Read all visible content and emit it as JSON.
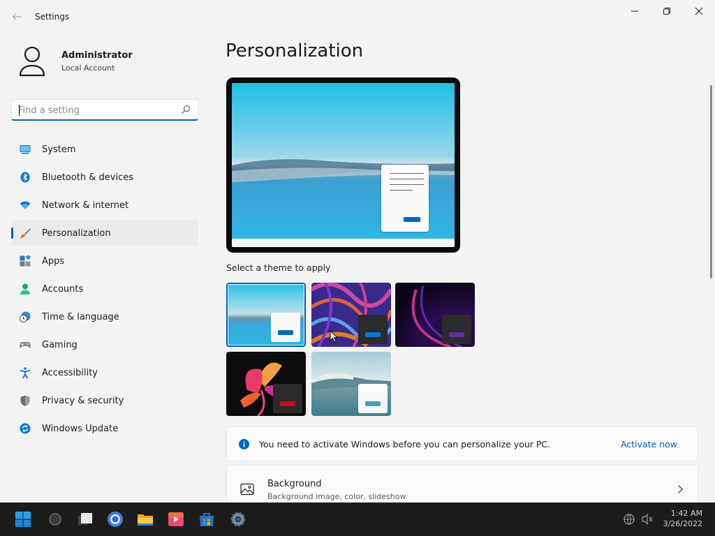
{
  "titlebar": {
    "app_title": "Settings",
    "back_icon": "back-arrow-icon",
    "controls": [
      "minimize-icon",
      "restore-icon",
      "close-icon"
    ]
  },
  "user": {
    "name": "Administrator",
    "account_type": "Local Account"
  },
  "search": {
    "placeholder": "Find a setting",
    "value": ""
  },
  "sidebar": {
    "items": [
      {
        "label": "System",
        "icon": "system-icon",
        "active": false
      },
      {
        "label": "Bluetooth & devices",
        "icon": "bluetooth-icon",
        "active": false
      },
      {
        "label": "Network & internet",
        "icon": "wifi-icon",
        "active": false
      },
      {
        "label": "Personalization",
        "icon": "brush-icon",
        "active": true
      },
      {
        "label": "Apps",
        "icon": "apps-icon",
        "active": false
      },
      {
        "label": "Accounts",
        "icon": "person-icon",
        "active": false
      },
      {
        "label": "Time & language",
        "icon": "clock-globe-icon",
        "active": false
      },
      {
        "label": "Gaming",
        "icon": "gamepad-icon",
        "active": false
      },
      {
        "label": "Accessibility",
        "icon": "accessibility-icon",
        "active": false
      },
      {
        "label": "Privacy & security",
        "icon": "shield-icon",
        "active": false
      },
      {
        "label": "Windows Update",
        "icon": "update-icon",
        "active": false
      }
    ]
  },
  "main": {
    "title": "Personalization",
    "theme_section_label": "Select a theme to apply",
    "themes": [
      {
        "name": "windows-light",
        "selected": true,
        "accent": "#0067c0"
      },
      {
        "name": "glow",
        "selected": false,
        "accent": "#0078d4"
      },
      {
        "name": "windows-dark",
        "selected": false,
        "accent": "#6b2d9c"
      },
      {
        "name": "captured-motion",
        "selected": false,
        "accent": "#c50f1f"
      },
      {
        "name": "flow",
        "selected": false,
        "accent": "#4f9fb0"
      }
    ],
    "activation": {
      "message": "You need to activate Windows before you can personalize your PC.",
      "link": "Activate now"
    },
    "background_row": {
      "title": "Background",
      "subtitle": "Background image, color, slideshow"
    }
  },
  "taskbar": {
    "apps": [
      "start-icon",
      "search-icon",
      "task-view-icon",
      "chrome-icon",
      "file-explorer-icon",
      "media-player-icon",
      "store-icon",
      "settings-icon"
    ],
    "time": "1:42 AM",
    "date": "3/26/2022"
  },
  "colors": {
    "accent": "#005fb8",
    "link": "#005fb8",
    "taskbar": "#1c1c1c"
  }
}
